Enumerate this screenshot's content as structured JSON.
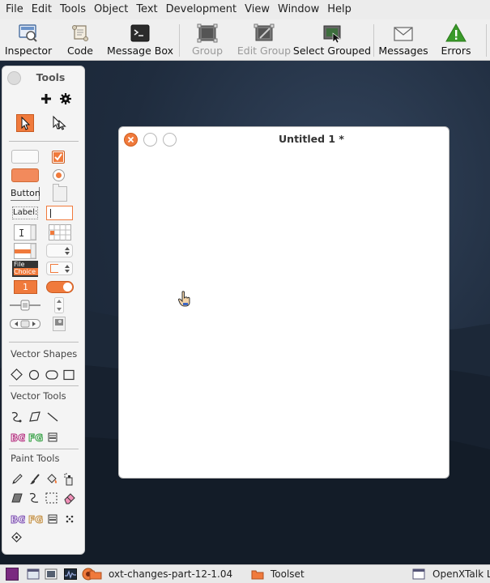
{
  "menubar": {
    "items": [
      "File",
      "Edit",
      "Tools",
      "Object",
      "Text",
      "Development",
      "View",
      "Window",
      "Help"
    ]
  },
  "toolbar": {
    "inspector": "Inspector",
    "code": "Code",
    "message_box": "Message Box",
    "group": "Group",
    "edit_group": "Edit Group",
    "select_grouped": "Select Grouped",
    "messages": "Messages",
    "errors": "Errors"
  },
  "tools_palette": {
    "title": "Tools",
    "button_label": "Button",
    "label_label": "Label:",
    "file_label": "File",
    "choice_label": "Choice",
    "stepper_value": "1",
    "vector_shapes": "Vector Shapes",
    "vector_tools": "Vector Tools",
    "paint_tools": "Paint Tools",
    "bg": "BG",
    "fg": "FG"
  },
  "document": {
    "title": "Untitled 1 *"
  },
  "taskbar": {
    "task1": "oxt-changes-part-12-1.04",
    "task2": "Toolset",
    "task3": "OpenXTalk Li"
  },
  "colors": {
    "accent_orange": "#f07a3c",
    "error_green": "#3a9a2a"
  }
}
